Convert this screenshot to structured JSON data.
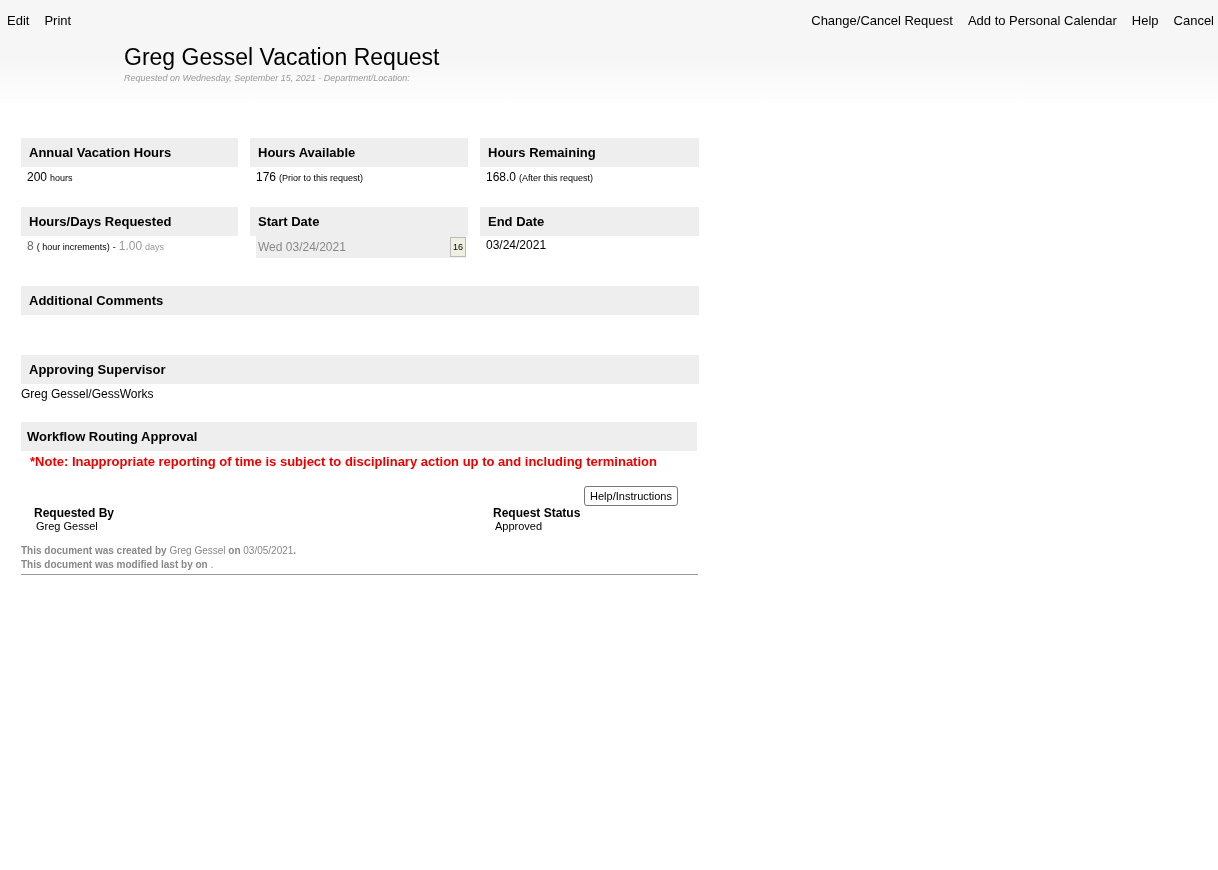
{
  "toolbar": {
    "left": [
      "Edit",
      "Print"
    ],
    "right": [
      "Change/Cancel Request",
      "Add to Personal Calendar",
      "Help",
      "Cancel"
    ]
  },
  "header": {
    "title": "Greg Gessel Vacation Request",
    "subtitle": "Requested on Wednesday, September 15, 2021 - Department/Location:"
  },
  "fields": [
    {
      "kind": "plain",
      "label": "Annual Vacation Hours",
      "value": "200",
      "note": "hours"
    },
    {
      "kind": "plain",
      "label": "Hours Available",
      "value": "176",
      "note": "(Prior to this request)"
    },
    {
      "kind": "plain",
      "label": "Hours Remaining",
      "value": "168.0",
      "note": "(After this request)"
    },
    {
      "kind": "hours_days",
      "label": "Hours/Days Requested",
      "value": "8",
      "note": "( hour increments)",
      "separator": "-",
      "days": "1.00",
      "days_unit": "days"
    },
    {
      "kind": "date_picker",
      "label": "Start Date",
      "value": "Wed 03/24/2021",
      "calendar": "16"
    },
    {
      "kind": "plain",
      "label": "End Date",
      "value": "03/24/2021"
    }
  ],
  "comments": {
    "label": "Additional Comments"
  },
  "supervisor": {
    "label": "Approving Supervisor",
    "value": "Greg Gessel/GessWorks"
  },
  "workflow": {
    "label": "Workflow Routing Approval",
    "note": "*Note: Inappropriate reporting of time is subject to disciplinary action up to and including termination",
    "help_button": "Help/Instructions",
    "requested_by": {
      "label": "Requested By",
      "value": "Greg Gessel"
    },
    "status": {
      "label": "Request Status",
      "value": "Approved"
    }
  },
  "footer": [
    "**This document was created by** Greg Gessel **on** 03/05/2021**.**",
    "**This document was modified last by  on** ."
  ]
}
